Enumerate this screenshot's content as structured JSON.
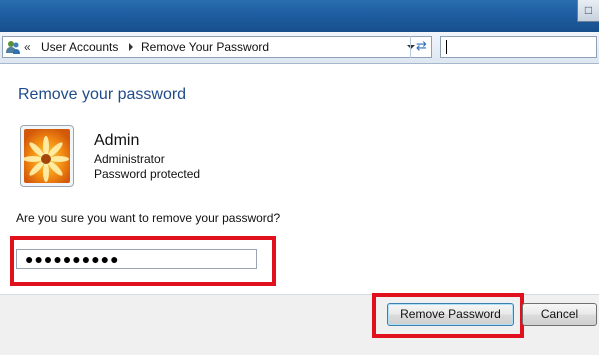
{
  "window": {
    "title_button": "□"
  },
  "address_bar": {
    "overflow_chevron": "«",
    "crumbs": [
      "User Accounts",
      "Remove Your Password"
    ],
    "refresh_glyph": "⇄"
  },
  "search": {
    "value": ""
  },
  "page": {
    "heading": "Remove your password",
    "user": {
      "name": "Admin",
      "role": "Administrator",
      "status": "Password protected"
    },
    "question": "Are you sure you want to remove your password?",
    "password_masked": "●●●●●●●●●●"
  },
  "buttons": {
    "remove_password": "Remove Password",
    "cancel": "Cancel"
  },
  "colors": {
    "highlight_frame": "#e0101c",
    "heading": "#1f4b8a"
  }
}
